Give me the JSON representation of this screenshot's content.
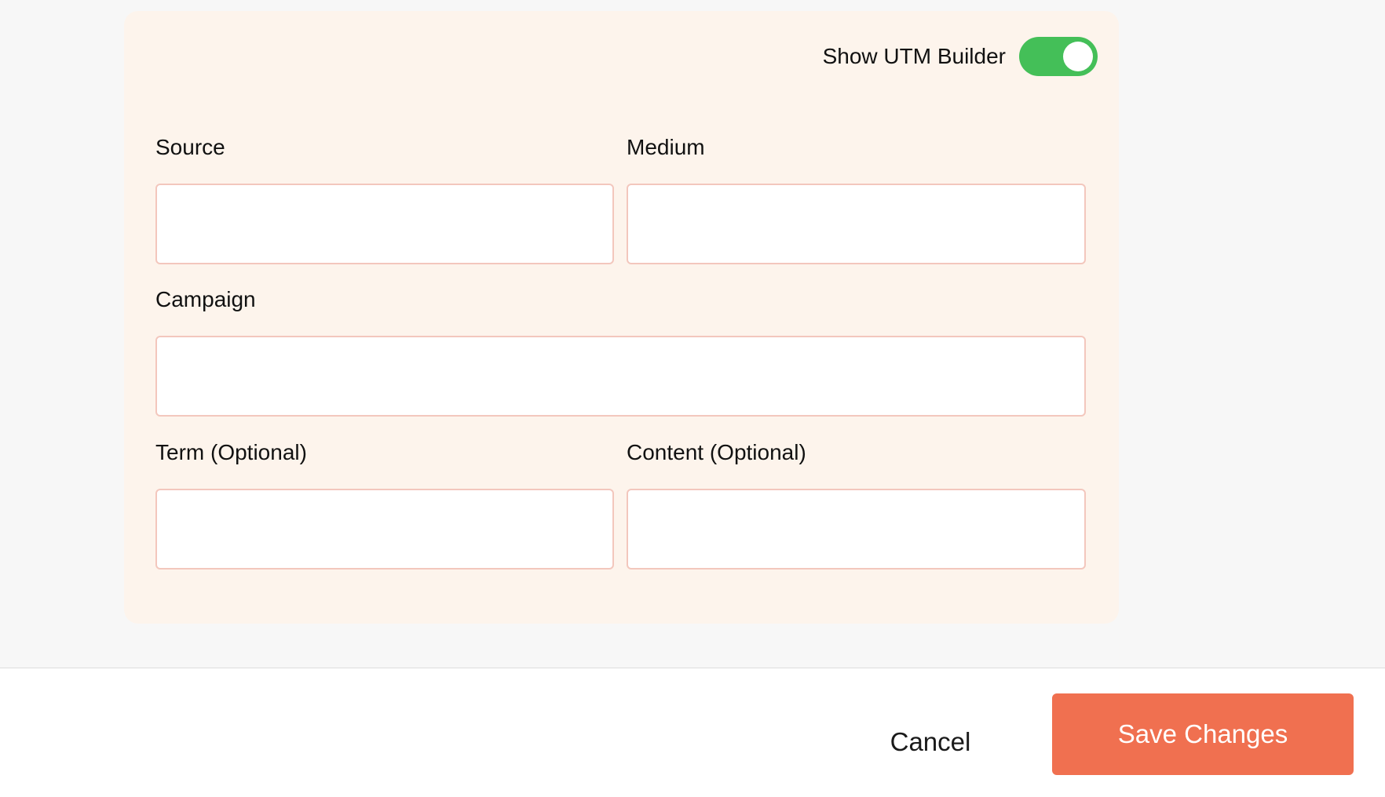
{
  "utm_builder": {
    "toggle_label": "Show UTM Builder",
    "toggle_on": true,
    "fields": {
      "source": {
        "label": "Source",
        "value": "",
        "placeholder": ""
      },
      "medium": {
        "label": "Medium",
        "value": "",
        "placeholder": ""
      },
      "campaign": {
        "label": "Campaign",
        "value": "",
        "placeholder": ""
      },
      "term": {
        "label": "Term (Optional)",
        "value": "",
        "placeholder": ""
      },
      "content": {
        "label": "Content (Optional)",
        "value": "",
        "placeholder": ""
      }
    }
  },
  "footer": {
    "cancel_label": "Cancel",
    "save_label": "Save Changes"
  },
  "colors": {
    "panel_background": "#fdf4ec",
    "toggle_on": "#44bf58",
    "input_border": "#f3c7bd",
    "primary_button": "#f07050"
  }
}
